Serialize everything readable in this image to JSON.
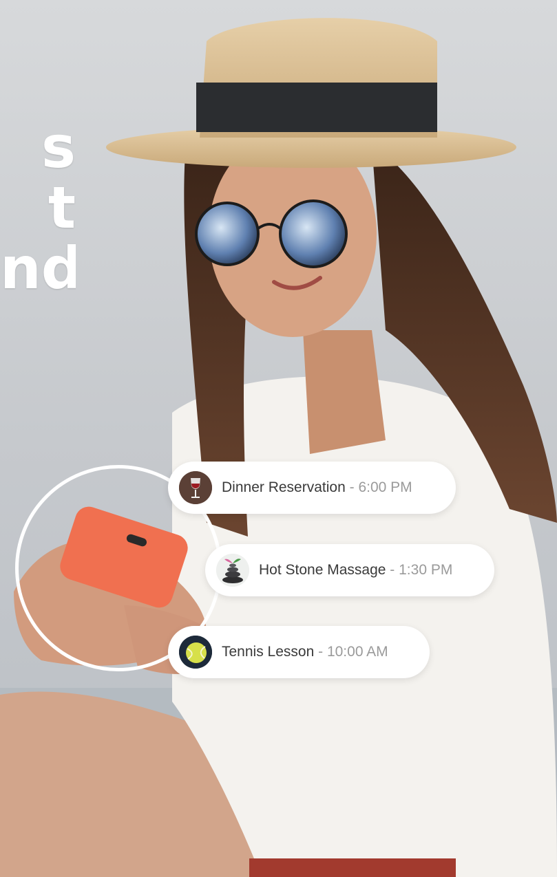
{
  "headline": {
    "lines": [
      "s",
      "t",
      "nd"
    ]
  },
  "schedule": [
    {
      "name": "Dinner Reservation",
      "separator": "-",
      "time": "6:00 PM",
      "icon": "wine-glass-icon"
    },
    {
      "name": "Hot Stone Massage",
      "separator": "-",
      "time": "1:30 PM",
      "icon": "spa-stones-icon"
    },
    {
      "name": "Tennis Lesson",
      "separator": "-",
      "time": "10:00 AM",
      "icon": "tennis-ball-icon"
    }
  ],
  "colors": {
    "pill_background": "#ffffff",
    "label_text": "#3a3a3a",
    "time_text": "#9a9a9a",
    "phone": "#f07050"
  }
}
